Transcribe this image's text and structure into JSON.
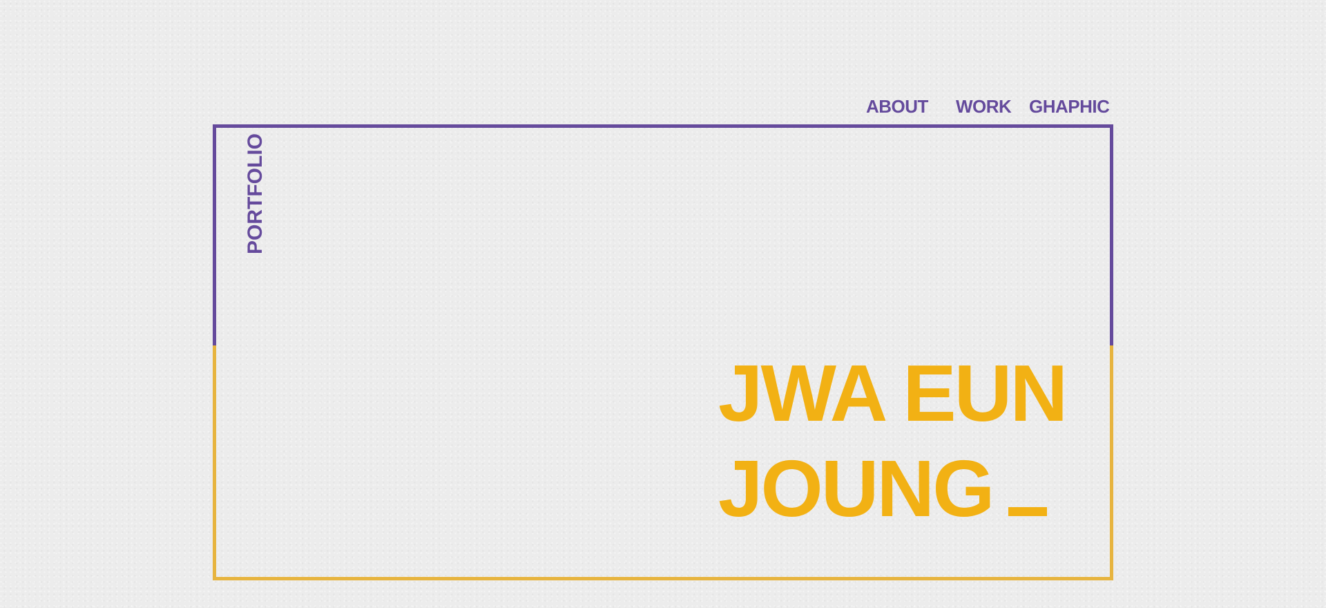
{
  "nav": {
    "items": [
      {
        "label": "ABOUT"
      },
      {
        "label": "WORK"
      },
      {
        "label": "GHAPHIC"
      }
    ]
  },
  "sidebar_label": "PORTFOLIO",
  "hero": {
    "line1": "JWA EUN",
    "line2": "JOUNG"
  },
  "colors": {
    "background": "#ececec",
    "purple": "#654a9c",
    "gold_frame": "#e7b43f",
    "gold_text": "#f2b114"
  }
}
